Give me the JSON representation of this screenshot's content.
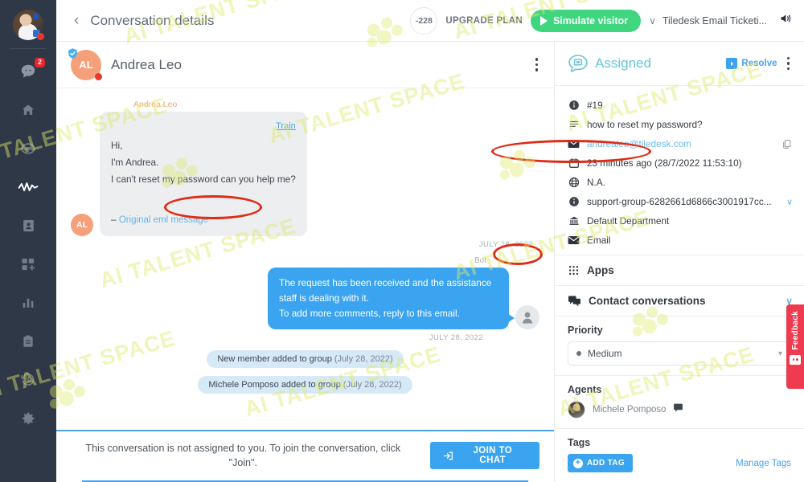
{
  "sidebar": {
    "avatar_name": "user-avatar",
    "items": [
      {
        "icon": "chat-bubble-icon",
        "label": "Conversations",
        "badge": "2"
      },
      {
        "icon": "home-icon",
        "label": "Home",
        "badge": ""
      },
      {
        "icon": "bot-icon",
        "label": "Bots",
        "badge": ""
      },
      {
        "icon": "activity-icon",
        "label": "Activity",
        "badge": ""
      },
      {
        "icon": "contacts-icon",
        "label": "Contacts",
        "badge": ""
      },
      {
        "icon": "apps-add-icon",
        "label": "Apps",
        "badge": ""
      },
      {
        "icon": "analytics-icon",
        "label": "Analytics",
        "badge": ""
      },
      {
        "icon": "clipboard-icon",
        "label": "Canned",
        "badge": ""
      },
      {
        "icon": "history-icon",
        "label": "History",
        "badge": ""
      },
      {
        "icon": "gear-icon",
        "label": "Settings",
        "badge": ""
      }
    ]
  },
  "topbar": {
    "back_label": "‹",
    "title": "Conversation details",
    "credits": "-228",
    "upgrade_label": "UPGRADE PLAN",
    "simulate_label": "Simulate visitor",
    "project_name": "Tiledesk Email Ticketi...",
    "project_chevron": "∨",
    "sound_icon": "speaker-icon"
  },
  "conversation": {
    "contact_initials": "AL",
    "contact_name": "Andrea Leo",
    "sender_label": "Andrea Leo",
    "train_label": "Train",
    "incoming_message": "Hi,\nI'm Andrea.\nI can't reset my password can you help me?\n\n–",
    "eml_link": "Original eml message",
    "incoming_timestamp": "JULY 28, 2022",
    "bot_label": "Bot",
    "bot_message": "The request has been received and the assistance staff is dealing with it.\nTo add more comments, reply to this email.",
    "bot_timestamp": "JULY 28, 2022",
    "system_events": [
      {
        "text": "New member added to group",
        "date": "(July 28, 2022)"
      },
      {
        "text": "Michele Pomposo added to group",
        "date": "(July 28, 2022)"
      }
    ],
    "join_text": "This conversation is not assigned to you. To join the conversation, click \"Join\".",
    "join_button": "JOIN TO CHAT"
  },
  "details": {
    "status_label": "Assigned",
    "resolve_label": "Resolve",
    "rows": [
      {
        "icon": "info-icon",
        "text": "#19",
        "tail": ""
      },
      {
        "icon": "subject-icon",
        "text": "how to reset my password?",
        "tail": ""
      },
      {
        "icon": "email-icon",
        "text": "andrealeo@tiledesk.com",
        "tail": "copy-icon",
        "is_link": true
      },
      {
        "icon": "calendar-icon",
        "text": "23 minutes ago (28/7/2022 11:53:10)",
        "tail": ""
      },
      {
        "icon": "globe-icon",
        "text": "N.A.",
        "tail": ""
      },
      {
        "icon": "info-icon",
        "text": "support-group-6282661d6866c3001917cc...",
        "tail": "∨"
      },
      {
        "icon": "department-icon",
        "text": "Default Department",
        "tail": ""
      },
      {
        "icon": "email-icon",
        "text": "Email",
        "tail": ""
      }
    ],
    "sections": [
      {
        "icon": "apps-grid-icon",
        "label": "Apps",
        "chevron": ""
      },
      {
        "icon": "conversations-icon",
        "label": "Contact conversations",
        "chevron": "∨"
      }
    ],
    "priority_label": "Priority",
    "priority_value": "Medium",
    "priority_caret": "▾",
    "agents_label": "Agents",
    "agent_name": "Michele Pomposo",
    "tags_label": "Tags",
    "add_tag_label": "ADD TAG",
    "add_tag_plus": "+",
    "manage_tags_label": "Manage Tags"
  },
  "feedback": {
    "label": "Feedback"
  },
  "watermark": {
    "text": "AI TALENT SPACE"
  },
  "colors": {
    "rail_bg": "#2f3847",
    "accent_blue": "#3aa4f0",
    "green": "#3fd67f",
    "assigned_cyan": "#63c5d8",
    "annotation_red": "#e02b16",
    "badge_red": "#e8232a",
    "feedback_red": "#ef3b4f"
  }
}
